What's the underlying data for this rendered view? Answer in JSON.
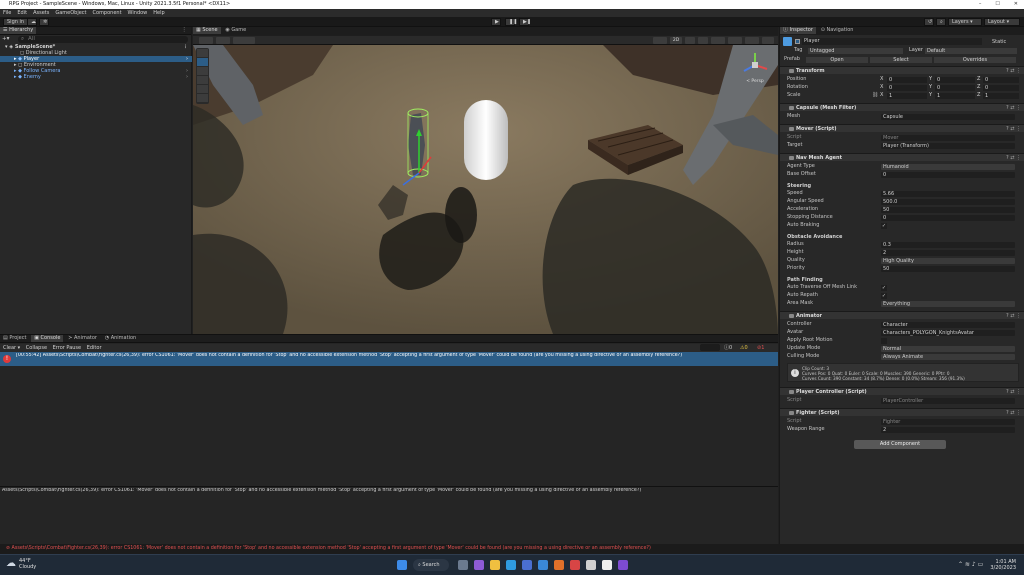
{
  "window": {
    "title": "RPG Project - SampleScene - Windows, Mac, Linux - Unity 2021.3.5f1 Personal* <DX11>",
    "controls": [
      "–",
      "☐",
      "✕"
    ]
  },
  "menu": [
    "File",
    "Edit",
    "Assets",
    "GameObject",
    "Component",
    "Window",
    "Help"
  ],
  "toolbar": {
    "sign_in": "Sign in",
    "layers": "Layers",
    "layout": "Layout"
  },
  "hierarchy": {
    "tab": "Hierarchy",
    "search_placeholder": "All",
    "items": [
      {
        "label": "SampleScene*",
        "bold": true,
        "indent": 0
      },
      {
        "label": "Directional Light",
        "indent": 1
      },
      {
        "label": "Player",
        "indent": 1,
        "selected": true,
        "prefab": true
      },
      {
        "label": "Environment",
        "indent": 1
      },
      {
        "label": "Follow Camera",
        "indent": 1,
        "prefab": true
      },
      {
        "label": "Enemy",
        "indent": 1,
        "prefab": true
      }
    ]
  },
  "scene": {
    "tabs": [
      "Scene",
      "Game"
    ],
    "mode_2d": "2D",
    "gizmo_label": "< Persp"
  },
  "console": {
    "tabs": [
      "Project",
      "Console",
      "Animator",
      "Animation"
    ],
    "toolbar": [
      "Clear",
      "Collapse",
      "Error Pause",
      "Editor"
    ],
    "counts": [
      "0",
      "0",
      "1"
    ],
    "selected_entry": "[00:55:42] Assets\\Scripts\\Combat\\Fighter.cs(26,39): error CS1061: 'Mover' does not contain a definition for 'Stop' and no accessible extension method 'Stop' accepting a first argument of type 'Mover' could be found (are you missing a using directive or an assembly reference?)",
    "detail": "Assets\\Scripts\\Combat\\Fighter.cs(26,39): error CS1061: 'Mover' does not contain a definition for 'Stop' and no accessible extension method 'Stop' accepting a first argument of type 'Mover' could be found (are you missing a using directive or an assembly reference?)"
  },
  "inspector": {
    "tabs": [
      "Inspector",
      "Navigation"
    ],
    "object_name": "Player",
    "static": "Static",
    "tag_label": "Tag",
    "tag": "Untagged",
    "layer_label": "Layer",
    "layer": "Default",
    "prefab_label": "Prefab",
    "prefab_open": "Open",
    "prefab_select": "Select",
    "prefab_overrides": "Overrides",
    "transform": {
      "header": "Transform",
      "rows": [
        {
          "label": "Position",
          "x": "0",
          "y": "0",
          "z": "0"
        },
        {
          "label": "Rotation",
          "x": "0",
          "y": "0",
          "z": "0"
        },
        {
          "label": "Scale",
          "x": "1",
          "y": "1",
          "z": "1"
        }
      ]
    },
    "mesh_filter": {
      "header": "Capsule (Mesh Filter)",
      "label": "Mesh",
      "value": "Capsule"
    },
    "mover": {
      "header": "Mover (Script)",
      "script_label": "Script",
      "script": "Mover",
      "target_label": "Target",
      "target": "Player (Transform)"
    },
    "nav": {
      "header": "Nav Mesh Agent",
      "agent_type_label": "Agent Type",
      "agent_type": "Humanoid",
      "base_offset_label": "Base Offset",
      "base_offset": "0",
      "steering": "Steering",
      "speed_label": "Speed",
      "speed": "5.66",
      "ang_label": "Angular Speed",
      "ang": "500.0",
      "acc_label": "Acceleration",
      "acc": "50",
      "stop_label": "Stopping Distance",
      "stop": "0",
      "brake_label": "Auto Braking",
      "avoid": "Obstacle Avoidance",
      "radius_label": "Radius",
      "radius": "0.3",
      "height_label": "Height",
      "height": "2",
      "quality_label": "Quality",
      "quality": "High Quality",
      "priority_label": "Priority",
      "priority": "50",
      "path": "Path Finding",
      "traverse_label": "Auto Traverse Off Mesh Link",
      "repath_label": "Auto Repath",
      "area_label": "Area Mask",
      "area": "Everything"
    },
    "animator": {
      "header": "Animator",
      "controller_label": "Controller",
      "controller": "Character",
      "avatar_label": "Avatar",
      "avatar": "Characters_POLYGON_KnightsAvatar",
      "root_label": "Apply Root Motion",
      "update_label": "Update Mode",
      "update": "Normal",
      "cull_label": "Culling Mode",
      "cull": "Always Animate",
      "info1": "Clip Count: 3",
      "info2": "Curves Pos: 0 Quat: 0 Euler: 0 Scale: 0 Muscles: 390 Generic: 0 PPtr: 0",
      "info3": "Curves Count: 390 Constant: 34 (8.7%) Dense: 0 (0.0%) Stream: 356 (91.3%)"
    },
    "player_controller": {
      "header": "Player Controller (Script)",
      "script_label": "Script",
      "script": "PlayerController"
    },
    "fighter": {
      "header": "Fighter (Script)",
      "script_label": "Script",
      "script": "Fighter",
      "range_label": "Weapon Range",
      "range": "2"
    },
    "add_component": "Add Component"
  },
  "status": "Assets\\Scripts\\Combat\\Fighter.cs(26,39): error CS1061: 'Mover' does not contain a definition for 'Stop' and no accessible extension method 'Stop' accepting a first argument of type 'Mover' could be found (are you missing a using directive or an assembly reference?)",
  "taskbar": {
    "temp": "44°F",
    "weather": "Cloudy",
    "search": "Search",
    "time": "1:01 AM",
    "date": "3/20/2023"
  }
}
